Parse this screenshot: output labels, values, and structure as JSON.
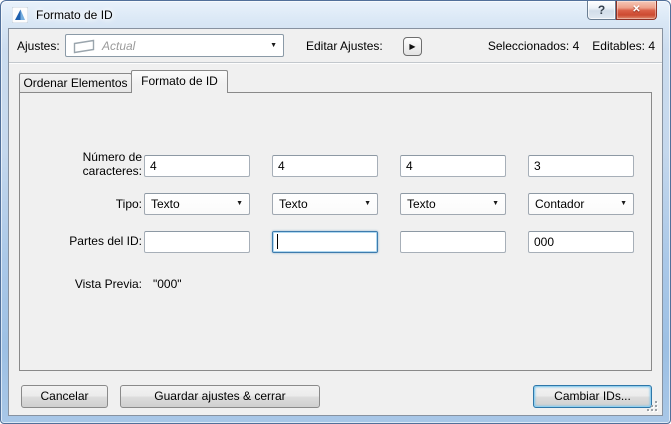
{
  "window": {
    "title": "Formato de ID"
  },
  "icons": {
    "help_glyph": "?",
    "close_glyph": "✕",
    "play_glyph": "▶",
    "dropdown_arrow_glyph": "▼"
  },
  "settings_bar": {
    "ajustes_label": "Ajustes:",
    "preset_value": "Actual",
    "editar_ajustes_label": "Editar Ajustes:",
    "seleccionados_text": "Seleccionados: 4",
    "editables_text": "Editables: 4"
  },
  "tabs": [
    {
      "label": "Ordenar Elementos",
      "active": false
    },
    {
      "label": "Formato de ID",
      "active": true
    }
  ],
  "form": {
    "numero_caracteres_label": "Número de caracteres:",
    "tipo_label": "Tipo:",
    "partes_label": "Partes del ID:",
    "vista_previa_label": "Vista Previa:",
    "vista_previa_value": "\"000\"",
    "columns": [
      {
        "caracteres": "4",
        "tipo": "Texto",
        "parte": ""
      },
      {
        "caracteres": "4",
        "tipo": "Texto",
        "parte": ""
      },
      {
        "caracteres": "4",
        "tipo": "Texto",
        "parte": ""
      },
      {
        "caracteres": "3",
        "tipo": "Contador",
        "parte": "000"
      }
    ]
  },
  "footer": {
    "cancel_label": "Cancelar",
    "save_label": "Guardar ajustes & cerrar",
    "change_ids_label": "Cambiar IDs..."
  }
}
